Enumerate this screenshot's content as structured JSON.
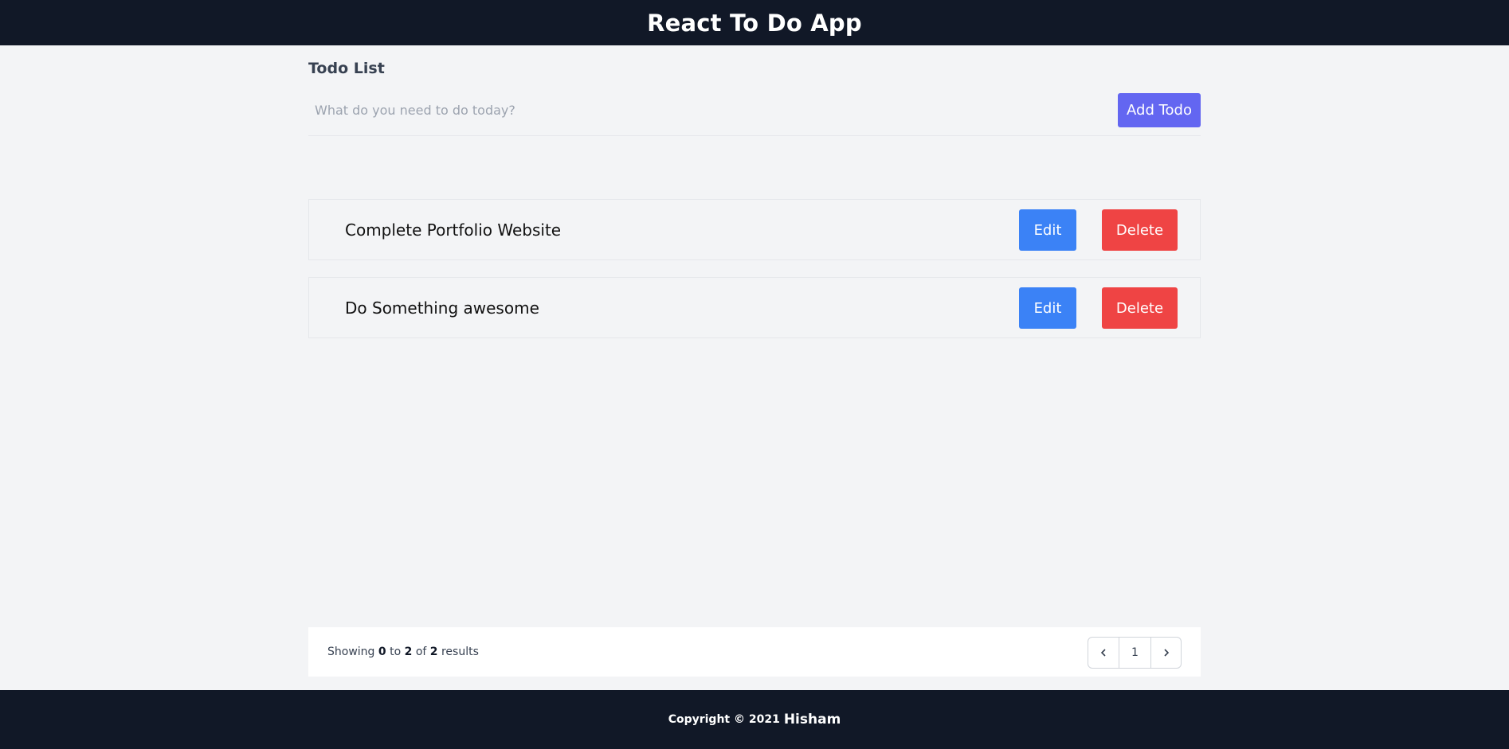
{
  "header": {
    "title": "React To Do App"
  },
  "todo_list": {
    "title": "Todo List",
    "input": {
      "value": "",
      "placeholder": "What do you need to do today?"
    },
    "add_label": "Add Todo",
    "items": [
      {
        "text": "Complete Portfolio Website",
        "edit_label": "Edit",
        "delete_label": "Delete"
      },
      {
        "text": "Do Something awesome",
        "edit_label": "Edit",
        "delete_label": "Delete"
      }
    ]
  },
  "pagination": {
    "prefix": "Showing",
    "from": "0",
    "to_word": "to",
    "to": "2",
    "of_word": "of",
    "total": "2",
    "suffix": "results",
    "current_page": "1",
    "prev_icon": "chevron-left-icon",
    "next_icon": "chevron-right-icon"
  },
  "footer": {
    "copyright": "Copyright © 2021",
    "author": "Hisham"
  },
  "colors": {
    "header_bg": "#111827",
    "add_button": "#6366f1",
    "edit_button": "#3b82f6",
    "delete_button": "#ef4444"
  }
}
